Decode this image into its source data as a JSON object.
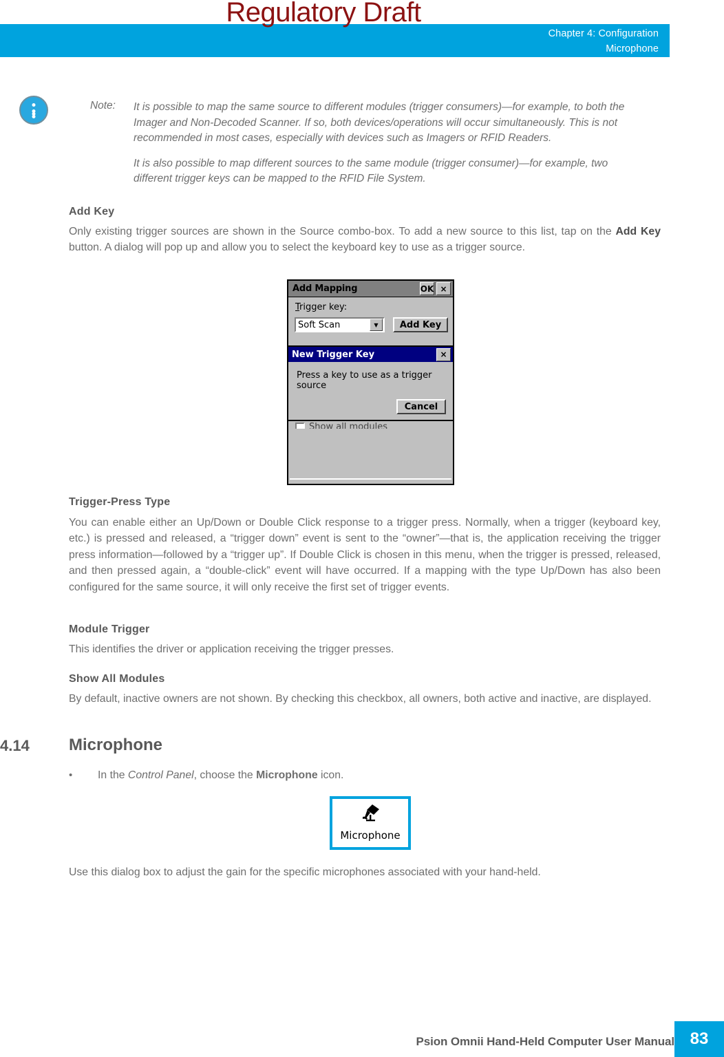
{
  "watermark": "Regulatory Draft",
  "header": {
    "line1": "Chapter 4:  Configuration",
    "line2": "Microphone",
    "bar_color": "#00a3de"
  },
  "note": {
    "icon": "info-icon",
    "label": "Note:",
    "paragraph1": "It is possible to map the same source to different modules (trigger consumers)—for example, to both the Imager and Non-Decoded Scanner. If so, both devices/operations will occur simultaneously. This is not recommended in most cases, especially with devices such as Imagers or RFID Readers.",
    "paragraph2": "It is also possible to map different sources to the same module (trigger consumer)—for example, two different trigger keys can be mapped to the RFID File System."
  },
  "sections": {
    "add_key": {
      "heading": "Add Key",
      "body_pre": "Only existing trigger sources are shown in the Source combo-box. To add a new source to this list, tap on the ",
      "body_bold": "Add Key",
      "body_post": " button. A dialog will pop up and allow you to select the keyboard key to use as a trigger source."
    },
    "trigger_press_type": {
      "heading": "Trigger-Press Type",
      "body": "You can enable either an Up/Down or Double Click response to a trigger press. Normally, when a trigger (keyboard key, etc.) is pressed and released, a “trigger down” event is sent to the “owner”—that is, the application receiving the trigger press information—followed by a “trigger up”. If Double Click is chosen in this menu, when the trigger is pressed, released, and then pressed again, a “double-click” event will have occurred. If a mapping with the type Up/Down has also been configured for the same source, it will only receive the first set of trigger events."
    },
    "module_trigger": {
      "heading": "Module Trigger",
      "body": "This identifies the driver or application receiving the trigger presses."
    },
    "show_all_modules": {
      "heading": "Show All Modules",
      "body": "By default, inactive owners are not shown. By checking this checkbox, all owners, both active and inactive, are displayed."
    },
    "microphone": {
      "number": "4.14",
      "title": "Microphone",
      "bullet_dot": "•",
      "bullet_pre": "In the ",
      "bullet_italic": "Control Panel",
      "bullet_mid": ", choose the ",
      "bullet_bold": "Microphone",
      "bullet_post": " icon.",
      "closing": "Use this dialog box to adjust the gain for the specific microphones associated with your hand-held."
    }
  },
  "dialog": {
    "title": "Add Mapping",
    "ok_label": "OK",
    "close_label": "×",
    "field_label_underline": "T",
    "field_label_rest": "rigger key:",
    "combo_value": "Soft Scan",
    "combo_arrow": "▼",
    "add_key_button": "Add Key",
    "checkbox_label_underline": "S",
    "checkbox_label_rest": "how all modules",
    "inner": {
      "title": "New Trigger Key",
      "close_label": "×",
      "message": "Press a key to use as a trigger source",
      "cancel_label": "Cancel"
    }
  },
  "mic_icon": {
    "glyph": "🎤",
    "caption": "Microphone",
    "border_color": "#00a3de"
  },
  "footer": {
    "text": "Psion Omnii Hand-Held Computer User Manual",
    "page": "83",
    "accent": "#00a3de"
  }
}
